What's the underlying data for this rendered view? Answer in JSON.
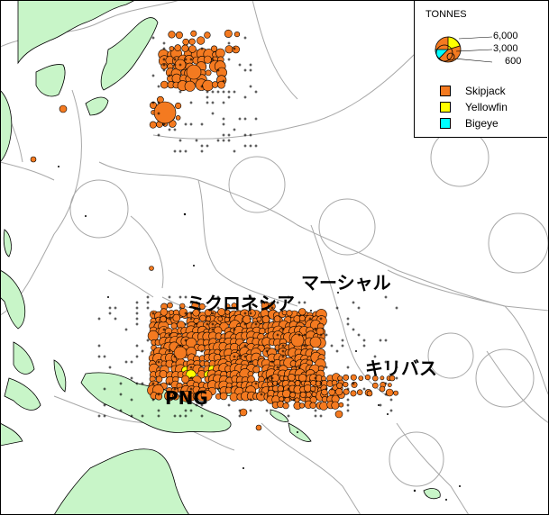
{
  "labels": {
    "micronesia": "ミクロネシア",
    "marshall": "マーシャル",
    "kiribati": "キリバス",
    "png": "PNG"
  },
  "legend": {
    "title": "TONNES",
    "sizes": [
      "6,000",
      "3,000",
      "600"
    ],
    "species": [
      {
        "name": "Skipjack",
        "color": "#f47a20"
      },
      {
        "name": "Yellowfin",
        "color": "#ffff00"
      },
      {
        "name": "Bigeye",
        "color": "#00ffff"
      }
    ]
  },
  "colors": {
    "land": "#c8f5c8",
    "boundary": "#a0a0a0",
    "catch": "#f47a20"
  }
}
